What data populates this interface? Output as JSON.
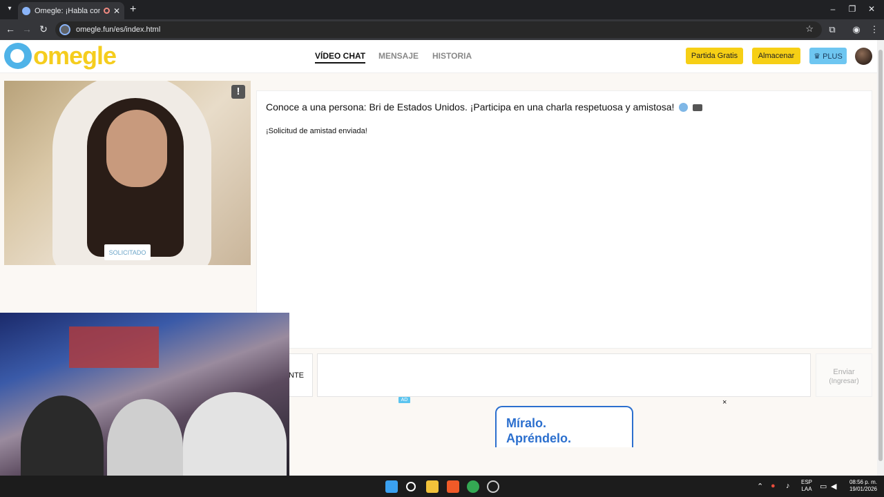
{
  "browser": {
    "tab_title": "Omegle: ¡Habla con Descon",
    "url": "omegle.fun/es/index.html"
  },
  "header": {
    "logo_text": "omegle",
    "nav": [
      "VÍDEO CHAT",
      "MENSAJE",
      "HISTORIA"
    ],
    "buttons": {
      "free_match": "Partida Gratis",
      "store": "Almacenar",
      "plus": "♛ PLUS"
    }
  },
  "video": {
    "report_symbol": "!",
    "requested_label": "SOLICITADO"
  },
  "chat": {
    "intro": "Conoce a una persona: Bri de Estados Unidos. ¡Participa en una charla respetuosa y amistosa!",
    "status": "¡Solicitud de amistad enviada!",
    "next_label_partial": "NTE",
    "send_label": "Enviar",
    "send_hint": "(Ingresar)"
  },
  "ad": {
    "tag": "AD",
    "close": "×",
    "text_line1": "Míralo.",
    "text_line2": "Apréndelo."
  },
  "taskbar": {
    "lang_line1": "ESP",
    "lang_line2": "LAA",
    "time": "08:56 p. m.",
    "date": "19/01/2026"
  },
  "colors": {
    "brand_yellow": "#f6cf15",
    "brand_blue": "#4fb3e8",
    "plus_blue": "#6ec6f1"
  }
}
